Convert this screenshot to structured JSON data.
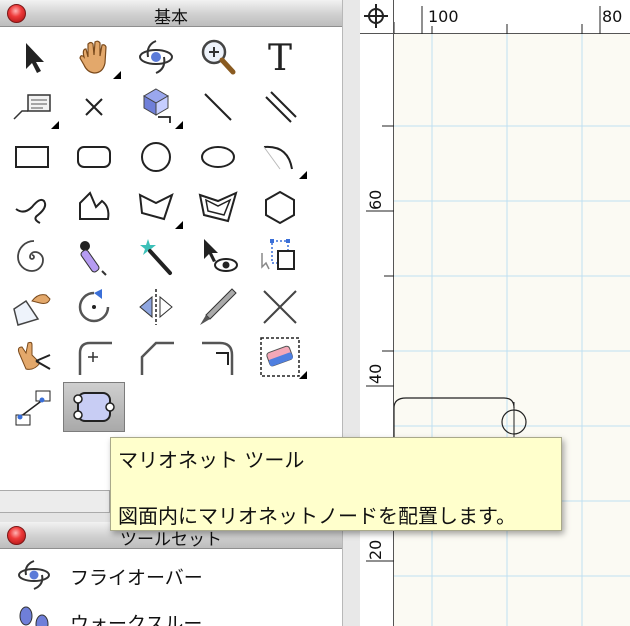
{
  "palette": {
    "title": "基本",
    "tools": [
      {
        "icon": "pointer-icon"
      },
      {
        "icon": "pan-hand-icon"
      },
      {
        "icon": "flyover-icon"
      },
      {
        "icon": "zoom-icon"
      },
      {
        "icon": "text-icon",
        "glyph": "T"
      },
      {
        "icon": "callout-icon"
      },
      {
        "icon": "locus-icon"
      },
      {
        "icon": "stake-object-icon"
      },
      {
        "icon": "line-icon"
      },
      {
        "icon": "double-line-icon"
      },
      {
        "icon": "rectangle-icon"
      },
      {
        "icon": "rounded-rectangle-icon"
      },
      {
        "icon": "circle-icon"
      },
      {
        "icon": "oval-icon"
      },
      {
        "icon": "arc-icon"
      },
      {
        "icon": "freehand-icon"
      },
      {
        "icon": "polyline-icon"
      },
      {
        "icon": "polygon-icon"
      },
      {
        "icon": "double-polygon-icon"
      },
      {
        "icon": "regular-polygon-icon"
      },
      {
        "icon": "spiral-icon"
      },
      {
        "icon": "eyedropper-icon"
      },
      {
        "icon": "magic-wand-icon"
      },
      {
        "icon": "visibility-icon"
      },
      {
        "icon": "reshape-icon"
      },
      {
        "icon": "offset-icon"
      },
      {
        "icon": "rotate-icon"
      },
      {
        "icon": "mirror-icon"
      },
      {
        "icon": "split-icon"
      },
      {
        "icon": "trim-icon"
      },
      {
        "icon": "clip-icon"
      },
      {
        "icon": "fillet-icon"
      },
      {
        "icon": "chamfer-icon"
      },
      {
        "icon": "connect-icon"
      },
      {
        "icon": "eraser-icon"
      },
      {
        "icon": "dimension-icon"
      },
      {
        "icon": "marionette-icon"
      }
    ]
  },
  "tooltip": {
    "title": "マリオネット ツール",
    "description": "図面内にマリオネットノードを配置します。"
  },
  "toolset": {
    "title": "ツールセット",
    "items": [
      {
        "label": "フライオーバー",
        "icon": "flyover-icon"
      },
      {
        "label": "ウォークスルー",
        "icon": "walkthrough-icon"
      }
    ]
  },
  "ruler": {
    "horizontal": [
      "100",
      "80"
    ],
    "vertical": [
      "60",
      "40",
      "20"
    ]
  },
  "colors": {
    "accent": "#3a6fd8",
    "tooltip": "#ffffcc",
    "grid": "#bfe0f2"
  }
}
